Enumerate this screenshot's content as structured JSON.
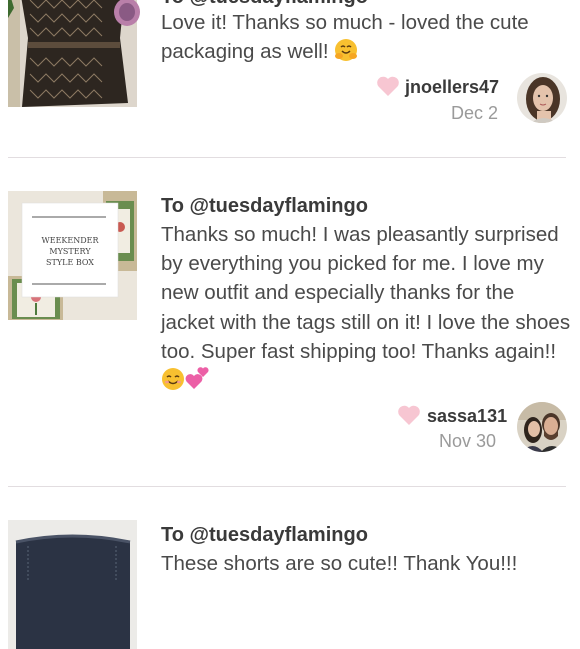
{
  "reviews": [
    {
      "to_line": "To @tuesdayflamingo",
      "message": "Love it! Thanks so much - loved the cute packaging as well!",
      "emoji": "hugging-face",
      "username": "jnoellers47",
      "date": "Dec 2"
    },
    {
      "to_line": "To @tuesdayflamingo",
      "message": "Thanks so much! I was pleasantly surprised by everything you picked for me. I love my new outfit and especially thanks for the jacket with the tags still on it! I love the shoes too. Super fast shipping too! Thanks again!!",
      "emoji": "smiling-face and two-hearts",
      "username": "sassa131",
      "date": "Nov 30",
      "thumb_text": [
        "WEEKENDER",
        "MYSTERY",
        "STYLE BOX"
      ]
    },
    {
      "to_line": "To @tuesdayflamingo",
      "message": "These shorts are so cute!! Thank You!!!"
    }
  ],
  "colors": {
    "heart": "#f7c6d2",
    "divider": "#e2dde0",
    "username": "#3a3a3a",
    "date": "#9a9a9a",
    "message": "#4a4a4a"
  }
}
